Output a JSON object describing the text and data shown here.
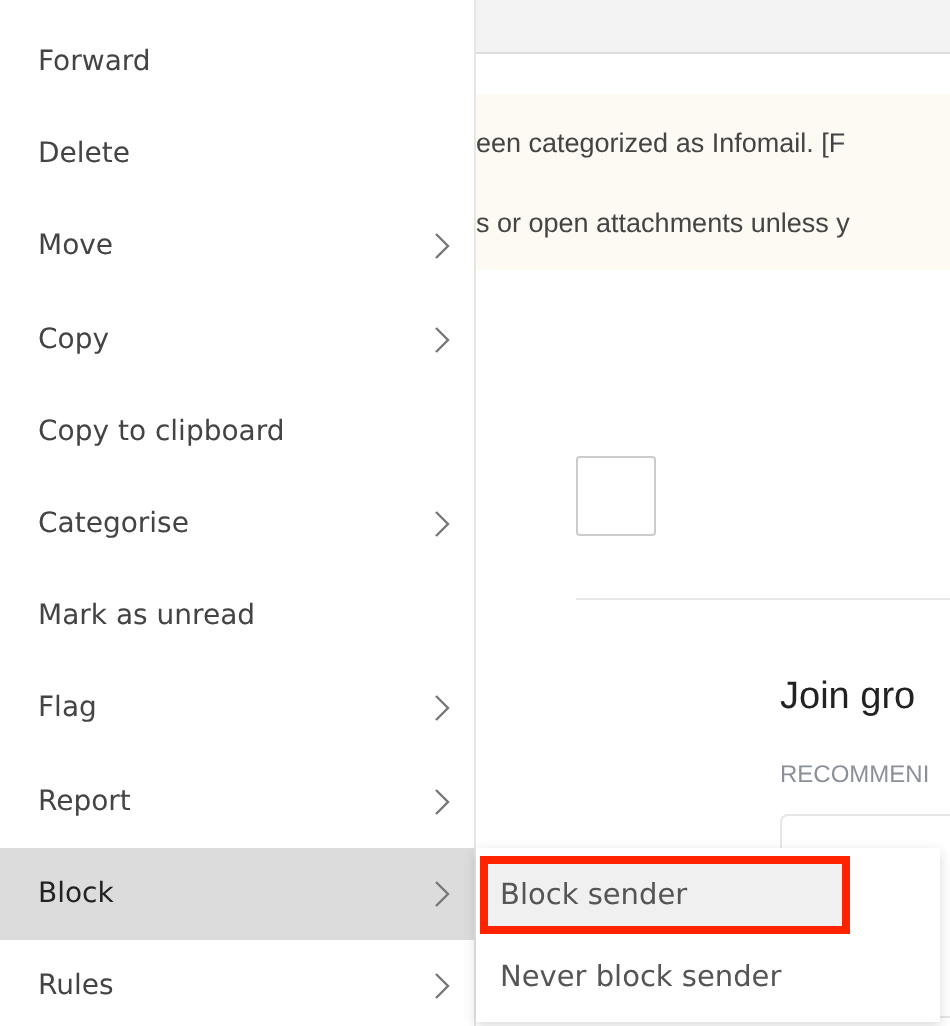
{
  "context_menu": {
    "items": [
      {
        "label": "Forward",
        "has_submenu": false,
        "selected": false
      },
      {
        "label": "Delete",
        "has_submenu": false,
        "selected": false
      },
      {
        "label": "Move",
        "has_submenu": true,
        "selected": false
      },
      {
        "label": "Copy",
        "has_submenu": true,
        "selected": false
      },
      {
        "label": "Copy to clipboard",
        "has_submenu": false,
        "selected": false
      },
      {
        "label": "Categorise",
        "has_submenu": true,
        "selected": false
      },
      {
        "label": "Mark as unread",
        "has_submenu": false,
        "selected": false
      },
      {
        "label": "Flag",
        "has_submenu": true,
        "selected": false
      },
      {
        "label": "Report",
        "has_submenu": true,
        "selected": false
      },
      {
        "label": "Block",
        "has_submenu": true,
        "selected": true
      },
      {
        "label": "Rules",
        "has_submenu": true,
        "selected": false
      }
    ]
  },
  "submenu": {
    "items": [
      {
        "label": "Block sender",
        "selected": true,
        "outlined": true
      },
      {
        "label": "Never block sender",
        "selected": false,
        "outlined": false
      }
    ]
  },
  "message": {
    "banner_lines": [
      "een categorized as Infomail. [F",
      "s or open attachments unless y"
    ],
    "checkbox": {
      "checked": false
    },
    "heading": "Join gro",
    "section_label": "RECOMMENI"
  }
}
